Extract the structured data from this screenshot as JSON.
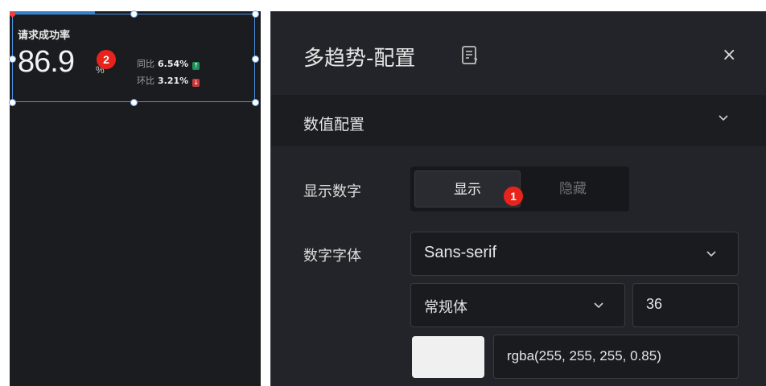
{
  "widget": {
    "title": "请求成功率",
    "value": "86.9",
    "unit": "%",
    "yoy_label": "同比",
    "yoy_value": "6.54%",
    "mom_label": "环比",
    "mom_value": "3.21%",
    "yoy_arrow": "↑",
    "mom_arrow": "↓"
  },
  "badges": {
    "one": "1",
    "two": "2"
  },
  "panel": {
    "title": "多趋势-配置",
    "close_glyph": "×",
    "section_title": "数值配置",
    "show_number_label": "显示数字",
    "show_option": "显示",
    "hide_option": "隐藏",
    "font_label": "数字字体",
    "font_family_value": "Sans-serif",
    "font_style_value": "常规体",
    "font_size_value": "36",
    "color_value": "rgba(255, 255, 255, 0.85)"
  },
  "colors": {
    "accent": "#4a90e2",
    "badge": "#e8231c",
    "up": "#1e8e5a",
    "down": "#c8393b",
    "swatch": "#f0f0f0"
  },
  "icons": [
    "doc-question-icon",
    "close-icon",
    "chevron-down-icon",
    "arrow-up-icon",
    "arrow-down-icon"
  ]
}
